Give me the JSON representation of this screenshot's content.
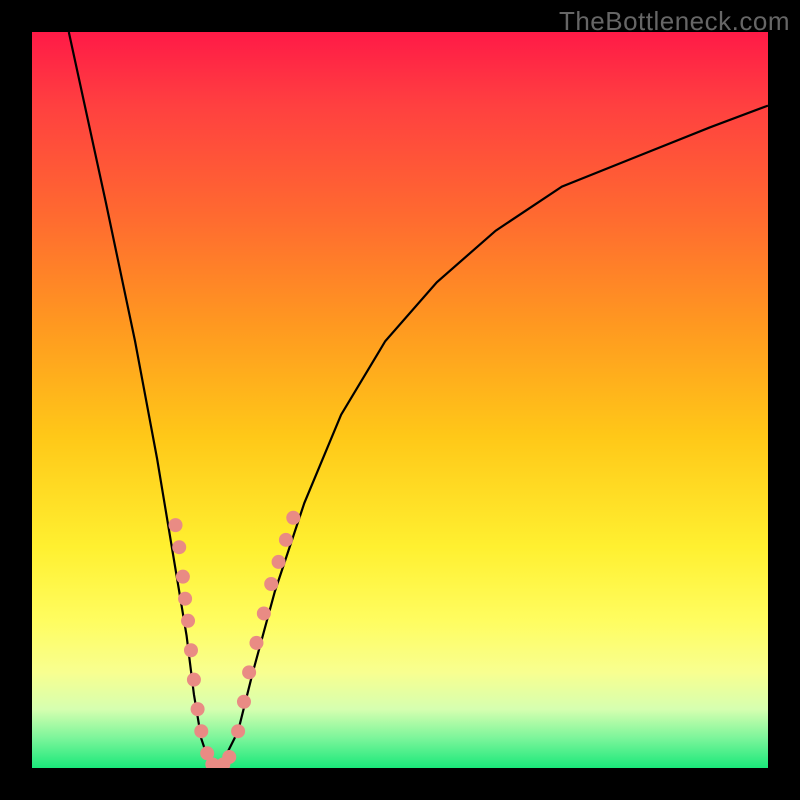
{
  "watermark": "TheBottleneck.com",
  "chart_data": {
    "type": "line",
    "title": "",
    "xlabel": "",
    "ylabel": "",
    "xlim": [
      0,
      100
    ],
    "ylim": [
      0,
      100
    ],
    "background_gradient": {
      "orientation": "vertical",
      "stops": [
        {
          "pos": 0,
          "color": "#ff1a47"
        },
        {
          "pos": 25,
          "color": "#ff6a30"
        },
        {
          "pos": 55,
          "color": "#ffc818"
        },
        {
          "pos": 80,
          "color": "#fffd60"
        },
        {
          "pos": 96,
          "color": "#7af59a"
        },
        {
          "pos": 100,
          "color": "#1ae87a"
        }
      ]
    },
    "series": [
      {
        "name": "bottleneck-curve",
        "color": "#000000",
        "x": [
          5,
          10,
          14,
          17,
          19,
          21,
          22,
          23,
          24,
          25,
          26,
          28,
          30,
          33,
          37,
          42,
          48,
          55,
          63,
          72,
          82,
          92,
          100
        ],
        "y": [
          100,
          77,
          58,
          42,
          30,
          18,
          10,
          4,
          1,
          0,
          1,
          5,
          13,
          24,
          36,
          48,
          58,
          66,
          73,
          79,
          83,
          87,
          90
        ]
      }
    ],
    "scatter": [
      {
        "name": "left-branch-dots",
        "color": "#e98b84",
        "points": [
          {
            "x": 19.5,
            "y": 33
          },
          {
            "x": 20.0,
            "y": 30
          },
          {
            "x": 20.5,
            "y": 26
          },
          {
            "x": 20.8,
            "y": 23
          },
          {
            "x": 21.2,
            "y": 20
          },
          {
            "x": 21.6,
            "y": 16
          },
          {
            "x": 22.0,
            "y": 12
          },
          {
            "x": 22.5,
            "y": 8
          },
          {
            "x": 23.0,
            "y": 5
          },
          {
            "x": 23.8,
            "y": 2
          }
        ]
      },
      {
        "name": "bottom-dots",
        "color": "#e98b84",
        "points": [
          {
            "x": 24.5,
            "y": 0.5
          },
          {
            "x": 25.2,
            "y": 0.2
          },
          {
            "x": 26.0,
            "y": 0.5
          },
          {
            "x": 26.8,
            "y": 1.5
          }
        ]
      },
      {
        "name": "right-branch-dots",
        "color": "#e98b84",
        "points": [
          {
            "x": 28.0,
            "y": 5
          },
          {
            "x": 28.8,
            "y": 9
          },
          {
            "x": 29.5,
            "y": 13
          },
          {
            "x": 30.5,
            "y": 17
          },
          {
            "x": 31.5,
            "y": 21
          },
          {
            "x": 32.5,
            "y": 25
          },
          {
            "x": 33.5,
            "y": 28
          },
          {
            "x": 34.5,
            "y": 31
          },
          {
            "x": 35.5,
            "y": 34
          }
        ]
      }
    ]
  }
}
